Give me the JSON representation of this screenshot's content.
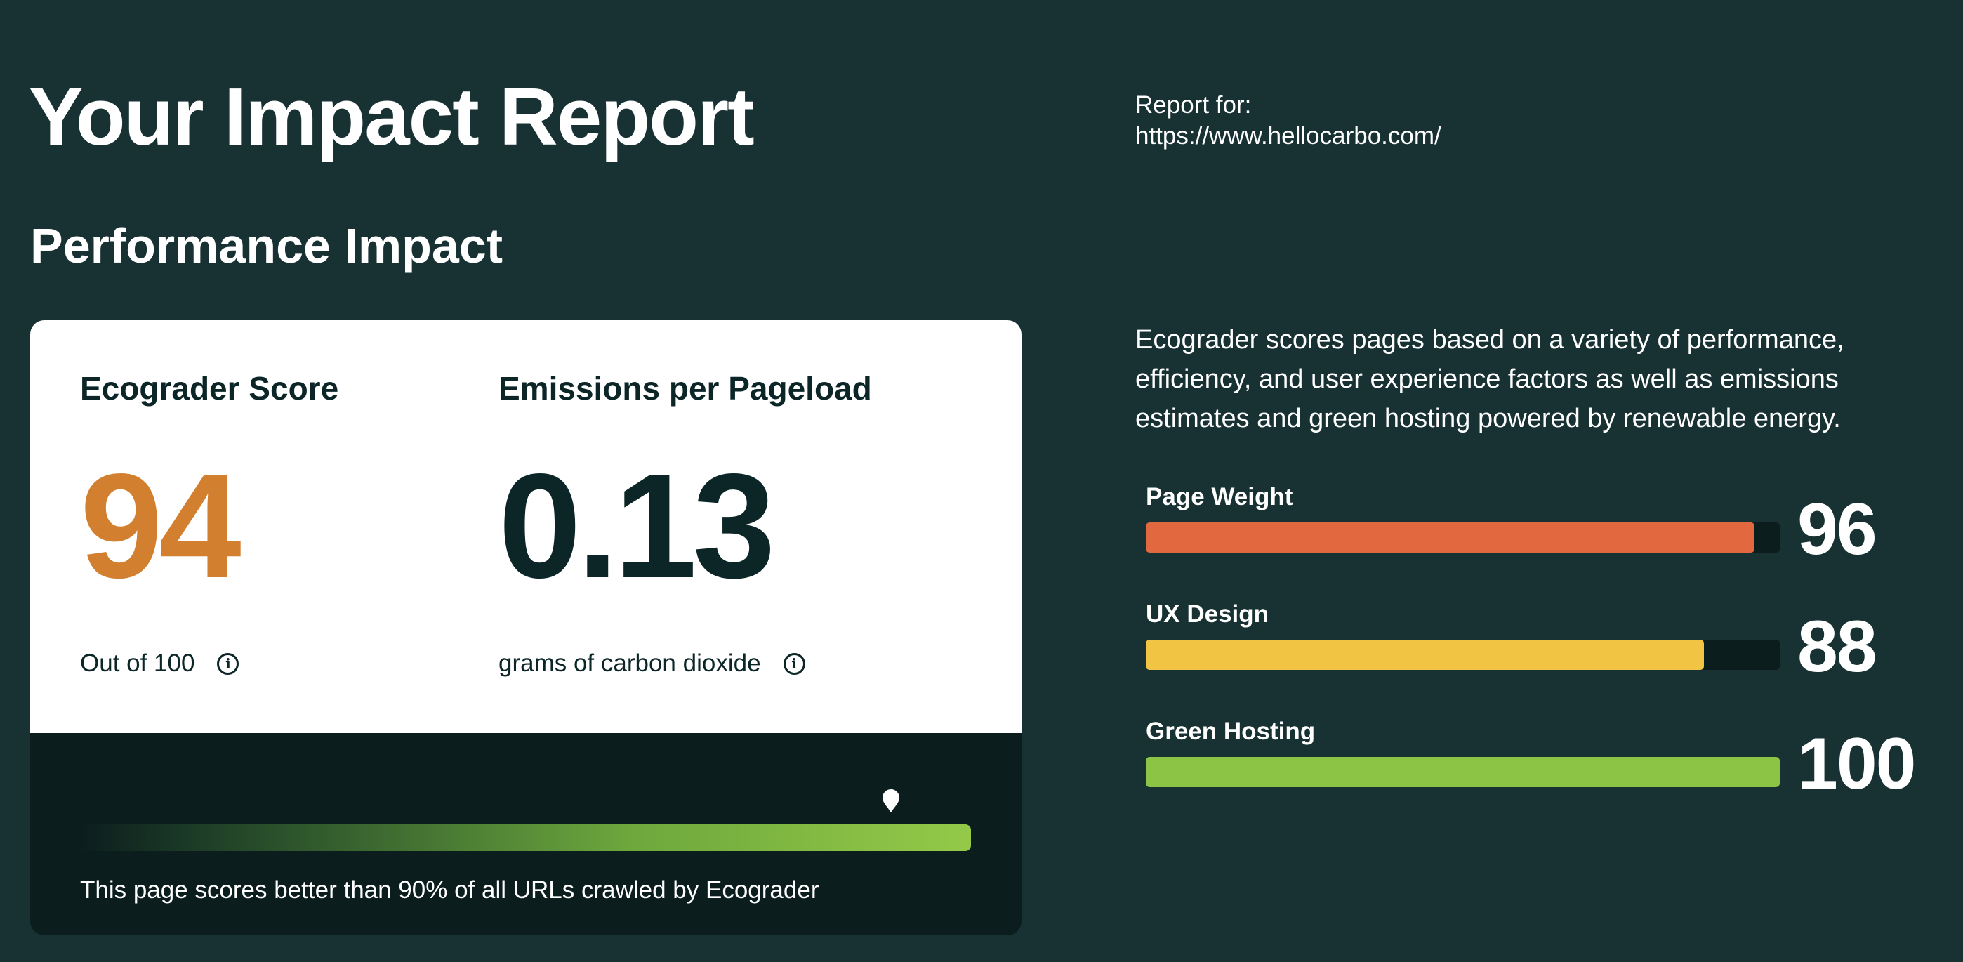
{
  "report": {
    "title": "Your Impact Report",
    "for_label": "Report for:",
    "url": "https://www.hellocarbo.com/"
  },
  "performance": {
    "section_title": "Performance Impact",
    "score_label": "Ecograder Score",
    "score_value": "94",
    "score_caption": "Out of 100",
    "emissions_label": "Emissions per Pageload",
    "emissions_value": "0.13",
    "emissions_caption": "grams of carbon dioxide",
    "percentile_fraction": 0.9,
    "percentile_text": "This page scores better than 90% of all URLs crawled by Ecograder"
  },
  "description": "Ecograder scores pages based on a variety of performance, efficiency, and user experience factors as well as emissions estimates and green hosting powered by renewable energy.",
  "factors": [
    {
      "label": "Page Weight",
      "score": "96",
      "fraction": 0.96,
      "color": "#e2683f"
    },
    {
      "label": "UX Design",
      "score": "88",
      "fraction": 0.88,
      "color": "#f2c443"
    },
    {
      "label": "Green Hosting",
      "score": "100",
      "fraction": 1.0,
      "color": "#8cc445"
    }
  ],
  "icons": {
    "info": "info-circle-icon",
    "marker": "map-pin-icon"
  }
}
